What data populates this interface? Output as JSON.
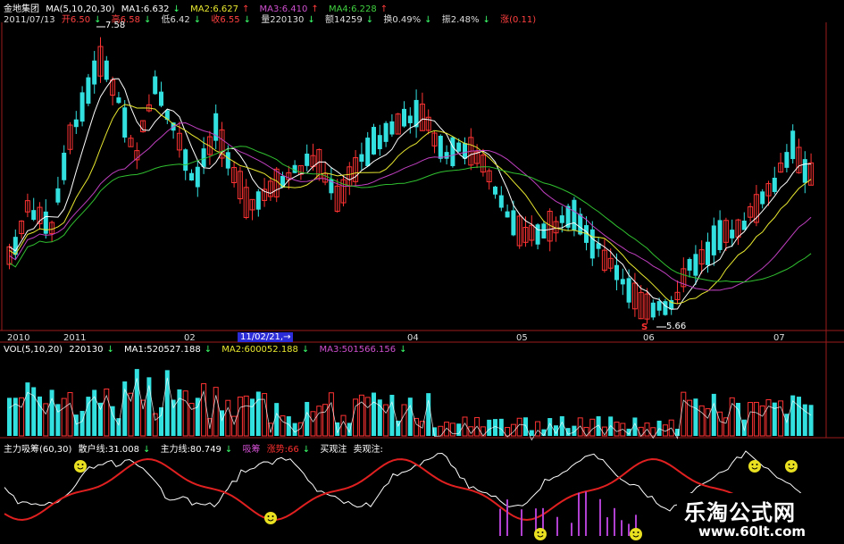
{
  "stock": {
    "name": "金地集团",
    "ma_label": "MA(5,10,20,30)",
    "ma1": "MA1:6.632",
    "ma2": "MA2:6.627",
    "ma3": "MA3:6.410",
    "ma4": "MA4:6.228"
  },
  "quote": {
    "date": "2011/07/13",
    "open": "开6.50",
    "high": "高6.58",
    "low": "低6.42",
    "close": "收6.55",
    "volume": "量220130",
    "amount": "额14259",
    "turnover": "换0.49%",
    "amplitude": "振2.48%",
    "change": "涨(0.11)"
  },
  "price_marks": {
    "high": "7.58",
    "low": "5.66"
  },
  "date_axis": [
    "2010",
    "2011",
    "02",
    "11/02/21,→",
    "04",
    "05",
    "06",
    "07"
  ],
  "volume_panel": {
    "label": "VOL(5,10,20)",
    "vol": "220130",
    "ma1": "MA1:520527.188",
    "ma2": "MA2:600052.188",
    "ma3": "MA3:501566.156"
  },
  "indicator_panel": {
    "label": "主力吸筹(60,30)",
    "retail": "散户线:31.008",
    "main": "主力线:80.749",
    "absorb": "吸筹",
    "rise": "涨势:66",
    "buy": "买观注",
    "sell": "卖观注:"
  },
  "watermark": {
    "title": "乐淘公式网",
    "url": "www.60lt.com"
  },
  "colors": {
    "up": "#ff3333",
    "down": "#33e0e0",
    "ma_white": "#ffffff",
    "ma_yellow": "#e8e830",
    "ma_purple": "#c040c0",
    "ma_green": "#30c030",
    "border": "#9b1b1b"
  }
}
